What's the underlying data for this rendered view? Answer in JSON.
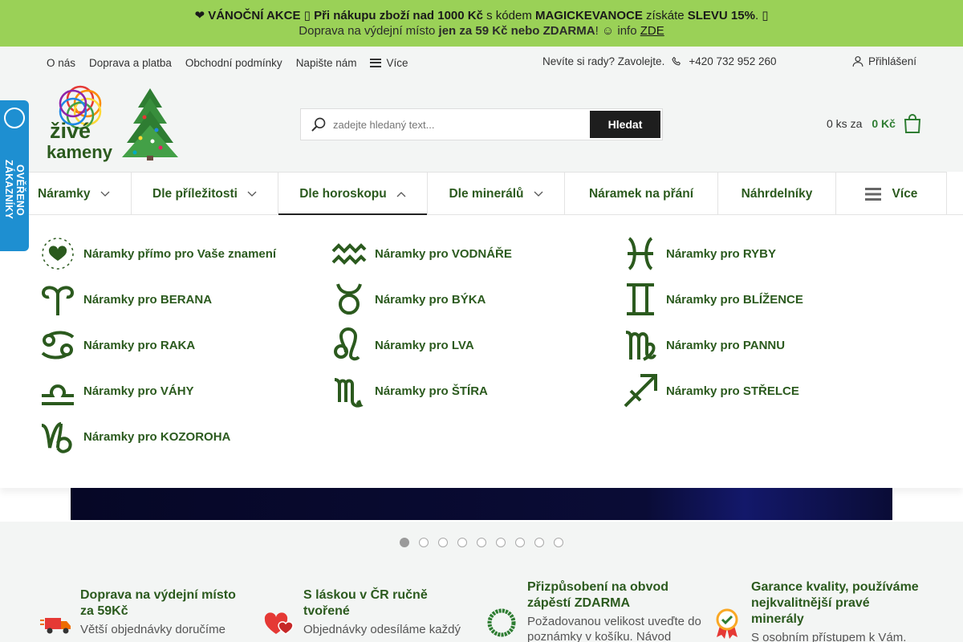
{
  "promo": {
    "line1_prefix": "❤ VÁNOČNÍ AKCE ",
    "line1_bold1": "▯ Při nákupu zboží nad 1000 Kč",
    "line1_mid": " s kódem ",
    "line1_code": "MAGICKEVANOCE",
    "line1_mid2": " získáte ",
    "line1_bold2": "SLEVU 15%",
    "line1_end": ". ▯",
    "line2_prefix": "Doprava na výdejní místo ",
    "line2_bold": "jen za 59 Kč nebo ZDARMA",
    "line2_mid": "! ☺ info ",
    "line2_link": "ZDE"
  },
  "topbar": {
    "links": [
      "O nás",
      "Doprava a platba",
      "Obchodní podmínky",
      "Napište nám"
    ],
    "more": "Více",
    "help": "Nevíte si rady? Zavolejte.",
    "phone": "+420 732 952 260",
    "login": "Přihlášení"
  },
  "logo": {
    "line1": "živé",
    "line2": "kameny"
  },
  "search": {
    "placeholder": "zadejte hledaný text...",
    "button": "Hledat"
  },
  "cart": {
    "count": "0 ks za",
    "price": "0 Kč"
  },
  "nav": [
    {
      "label": "Náramky"
    },
    {
      "label": "Dle příležitosti"
    },
    {
      "label": "Dle horoskopu"
    },
    {
      "label": "Dle minerálů"
    },
    {
      "label": "Náramek na přání"
    },
    {
      "label": "Náhrdelníky"
    },
    {
      "label": "Více"
    }
  ],
  "mega": [
    {
      "label": "Náramky přímo pro Vaše znamení",
      "icon": "zodiac-wheel-icon"
    },
    {
      "label": "Náramky pro VODNÁŘE",
      "icon": "aquarius-icon"
    },
    {
      "label": "Náramky pro RYBY",
      "icon": "pisces-icon"
    },
    {
      "label": "Náramky pro BERANA",
      "icon": "aries-icon"
    },
    {
      "label": "Náramky pro BÝKA",
      "icon": "taurus-icon"
    },
    {
      "label": "Náramky pro BLÍŽENCE",
      "icon": "gemini-icon"
    },
    {
      "label": "Náramky pro RAKA",
      "icon": "cancer-icon"
    },
    {
      "label": "Náramky pro LVA",
      "icon": "leo-icon"
    },
    {
      "label": "Náramky pro PANNU",
      "icon": "virgo-icon"
    },
    {
      "label": "Náramky pro VÁHY",
      "icon": "libra-icon"
    },
    {
      "label": "Náramky pro ŠTÍRA",
      "icon": "scorpio-icon"
    },
    {
      "label": "Náramky pro STŘELCE",
      "icon": "sagittarius-icon"
    },
    {
      "label": "Náramky pro KOZOROHA",
      "icon": "capricorn-icon"
    }
  ],
  "slider": {
    "count": 9,
    "active": 1
  },
  "benefits": [
    {
      "title": "Doprava na výdejní místo za 59Kč",
      "text": "Větší objednávky doručíme"
    },
    {
      "title": "S láskou v ČR ručně tvořené",
      "text": "Objednávky odesíláme každý"
    },
    {
      "title": "Přizpůsobení na obvod zápěstí ZDARMA",
      "text": "Požadovanou velikost uveďte do poznámky v košíku. Návod"
    },
    {
      "title": "Garance kvality, používáme nejkvalitnější pravé minerály",
      "text": "S osobním přístupem k Vám."
    }
  ],
  "badge": {
    "text": "OVĚŘENO ZÁKAZNÍKY"
  },
  "colors": {
    "promo_bg": "#9ad157",
    "accent_green": "#2b5a1e",
    "badge_blue": "#1e8fd1"
  }
}
